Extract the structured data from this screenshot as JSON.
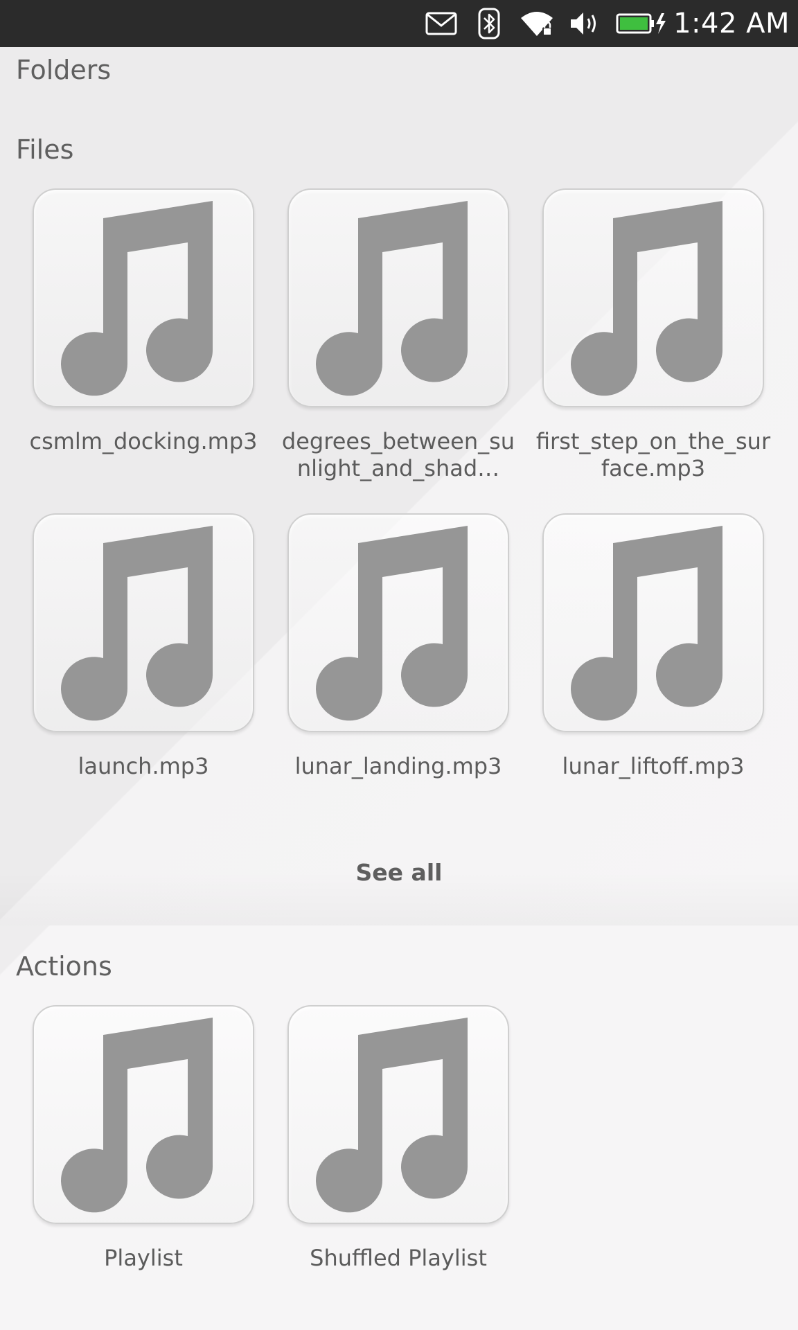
{
  "status_bar": {
    "time": "1:42 AM",
    "indicators": [
      "envelope-icon",
      "bluetooth-icon",
      "wifi-icon",
      "volume-icon",
      "battery-charging-icon"
    ],
    "battery_color": "#3fbf3f"
  },
  "sections": {
    "folders": {
      "title": "Folders"
    },
    "files": {
      "title": "Files",
      "items": [
        {
          "label": "csmlm_docking.mp3",
          "icon": "music-note-icon"
        },
        {
          "label": "degrees_between_sunlight_and_shad…",
          "icon": "music-note-icon"
        },
        {
          "label": "first_step_on_the_surface.mp3",
          "icon": "music-note-icon"
        },
        {
          "label": "launch.mp3",
          "icon": "music-note-icon"
        },
        {
          "label": "lunar_landing.mp3",
          "icon": "music-note-icon"
        },
        {
          "label": "lunar_liftoff.mp3",
          "icon": "music-note-icon"
        }
      ],
      "see_all_label": "See all"
    },
    "actions": {
      "title": "Actions",
      "items": [
        {
          "label": "Playlist",
          "icon": "music-note-icon"
        },
        {
          "label": "Shuffled Playlist",
          "icon": "music-note-icon"
        }
      ]
    }
  },
  "colors": {
    "status_bar_bg": "#2b2b2b",
    "icon_gray": "#969696",
    "text": "#5d5d5d"
  }
}
